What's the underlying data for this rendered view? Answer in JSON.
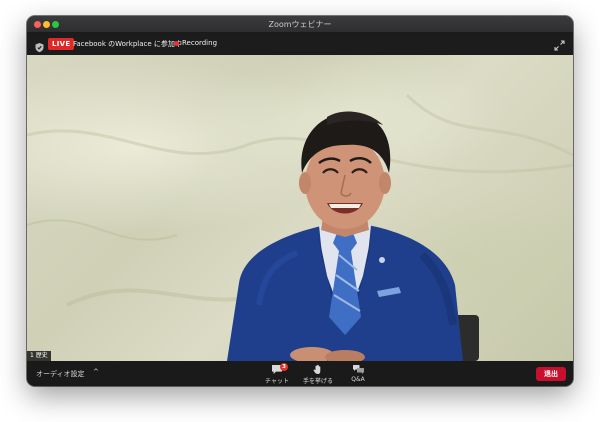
{
  "window": {
    "title": "Zoomウェビナー"
  },
  "topbar": {
    "live_label": "LIVE",
    "meeting_title": "Facebook のWorkplace に参加中",
    "recording_label": "Recording"
  },
  "video": {
    "participant_count": "1 歴史"
  },
  "controls": {
    "audio_settings_label": "オーディオ設定",
    "audio_caret": "^",
    "chat_label": "チャット",
    "chat_badge": "3",
    "raise_hand_label": "手を挙げる",
    "qa_label": "Q&A",
    "leave_label": "退出"
  },
  "colors": {
    "live_red": "#e02828",
    "leave_red": "#c8102e",
    "recording_dot": "#e8332f"
  }
}
